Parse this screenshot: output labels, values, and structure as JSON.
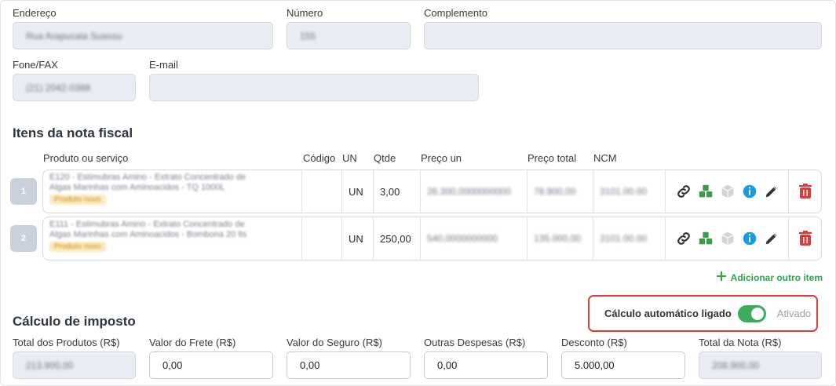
{
  "address": {
    "endereco_label": "Endereço",
    "endereco_value": "Rua Arapucaia Suassu",
    "numero_label": "Número",
    "numero_value": "155",
    "complemento_label": "Complemento",
    "complemento_value": "",
    "fone_label": "Fone/FAX",
    "fone_value": "(21) 2042-0388",
    "email_label": "E-mail",
    "email_value": ""
  },
  "items": {
    "title": "Itens da nota fiscal",
    "headers": {
      "produto": "Produto ou serviço",
      "codigo": "Código",
      "un": "UN",
      "qtde": "Qtde",
      "preco_un": "Preço un",
      "preco_total": "Preço total",
      "ncm": "NCM"
    },
    "rows": [
      {
        "index": "1",
        "product_line1": "E120 - Estimubras Amino - Extrato Concentrado de",
        "product_line2": "Algas Marinhas com Aminoacidos - TQ 1000L",
        "product_tag": "Produto novo",
        "codigo": "",
        "un": "UN",
        "qtde": "3,00",
        "preco_un": "26.300,0000000000",
        "preco_total": "78.900,00",
        "ncm": "3101.00.00"
      },
      {
        "index": "2",
        "product_line1": "E111 - Estimubras Amino - Extrato Concentrado de",
        "product_line2": "Algas Marinhas com Aminoacidos - Bombona 20 lts",
        "product_tag": "Produto novo",
        "codigo": "",
        "un": "UN",
        "qtde": "250,00",
        "preco_un": "540,0000000000",
        "preco_total": "135.000,00",
        "ncm": "3101.00.00"
      }
    ],
    "add_label": "Adicionar outro item"
  },
  "tax": {
    "title": "Cálculo de imposto",
    "auto_label": "Cálculo automático ligado",
    "auto_status": "Ativado",
    "auto_on": true,
    "total_produtos_label": "Total dos Produtos (R$)",
    "total_produtos_value": "213.900,00",
    "frete_label": "Valor do Frete (R$)",
    "frete_value": "0,00",
    "seguro_label": "Valor do Seguro (R$)",
    "seguro_value": "0,00",
    "outras_label": "Outras Despesas (R$)",
    "outras_value": "0,00",
    "desconto_label": "Desconto (R$)",
    "desconto_value": "5.000,00",
    "total_nota_label": "Total da Nota (R$)",
    "total_nota_value": "208.900,00"
  },
  "icons": [
    "link-icon",
    "boxes-icon",
    "box-icon",
    "info-icon",
    "pencil-icon",
    "trash-icon",
    "plus-icon"
  ],
  "colors": {
    "accent_green": "#3cac5c",
    "danger": "#e03a3a",
    "info": "#1a9be0"
  }
}
